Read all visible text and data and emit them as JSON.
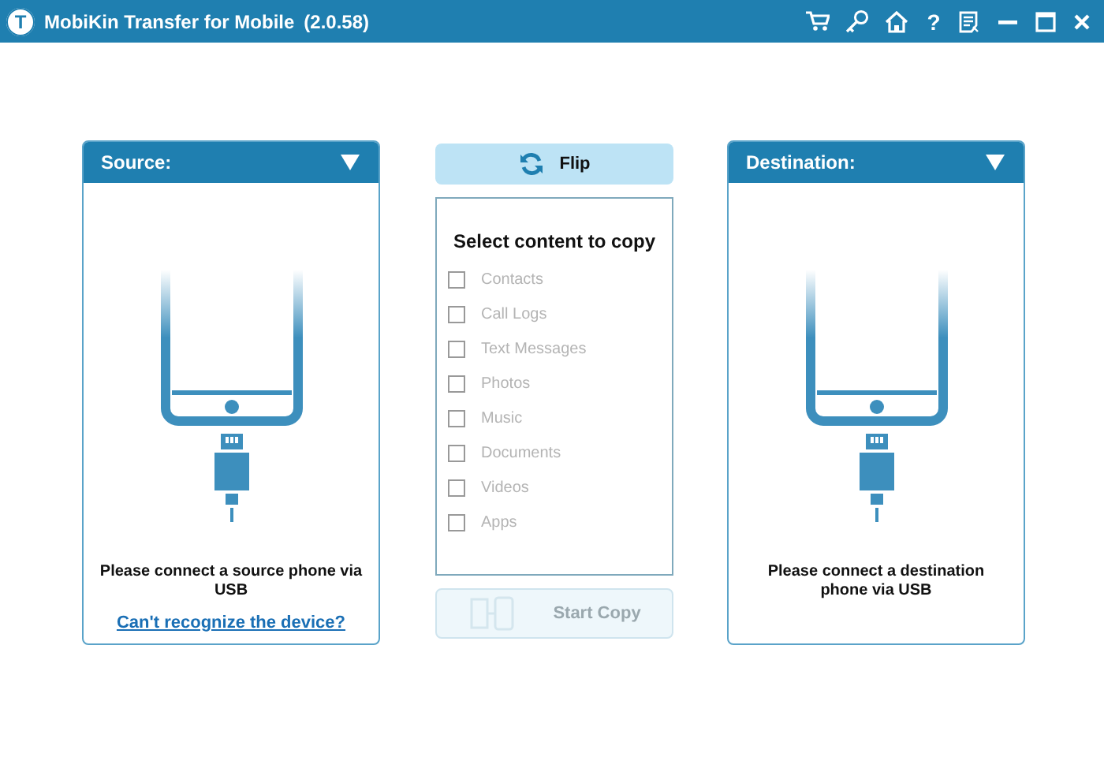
{
  "window": {
    "logo": "T",
    "title": "MobiKin Transfer for Mobile",
    "version": "(2.0.58)",
    "help": "?"
  },
  "source": {
    "title": "Source:",
    "message": "Please connect a source phone via USB",
    "link": "Can't recognize the device?"
  },
  "flip_button": {
    "label": "Flip"
  },
  "content": {
    "title": "Select content to copy",
    "items": [
      {
        "label": "Contacts",
        "checked": false,
        "disabled": true
      },
      {
        "label": "Call Logs",
        "checked": false,
        "disabled": true
      },
      {
        "label": "Text Messages",
        "checked": false,
        "disabled": true
      },
      {
        "label": "Photos",
        "checked": false,
        "disabled": true
      },
      {
        "label": "Music",
        "checked": false,
        "disabled": true
      },
      {
        "label": "Documents",
        "checked": false,
        "disabled": true
      },
      {
        "label": "Videos",
        "checked": false,
        "disabled": true
      },
      {
        "label": "Apps",
        "checked": false,
        "disabled": true
      }
    ]
  },
  "start_button": {
    "label": "Start Copy",
    "disabled": true
  },
  "destination": {
    "title": "Destination:",
    "message": "Please connect a destination phone via USB"
  }
}
